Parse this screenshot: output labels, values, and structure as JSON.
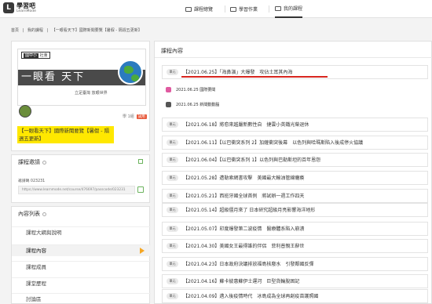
{
  "app": {
    "logo_name": "學習吧",
    "logo_sub": "LearnMode",
    "logo_glyph": "L"
  },
  "nav": [
    {
      "label": "課程總覽",
      "icon": "book-icon"
    },
    {
      "label": "學習作業",
      "icon": "clipboard-icon"
    },
    {
      "label": "我的課程",
      "icon": "course-icon",
      "active": true
    }
  ],
  "breadcrumb": [
    "首頁",
    "|",
    "我的課程",
    "|",
    "【一眼看天下】國際新聞要覽【暑假 - 隔週五更新】"
  ],
  "course": {
    "tag_left": "國中小",
    "tag_right": "社會",
    "banner_title": "一眼看 天下",
    "banner_sub": "立足臺灣 放眼世界",
    "meta_count": "學 1組",
    "badge": "試用",
    "title": "【一眼看天下】國際新聞要覽【暑假 - 隔週五更新】"
  },
  "code": {
    "heading": "課程邀請",
    "code_label": "邀請碼 023231",
    "url": "https://www.learnmode.net/course/476697/passcode/023231"
  },
  "menu": {
    "heading": "內容列表",
    "items": [
      {
        "label": "課程大綱與說明"
      },
      {
        "label": "課程內容",
        "active": true
      },
      {
        "label": "課程成員"
      },
      {
        "label": "課堂歷程"
      },
      {
        "label": "討論區"
      }
    ]
  },
  "content": {
    "heading": "課程內容",
    "rows": [
      {
        "pill": "單元",
        "text": "【2021.06.25】「海鼻演」大爆發　攻佔土耳其內海"
      },
      {
        "pill": "單元",
        "text": "【2021.06.18】將愈來越嚴新數性自　捷雲小英鐵光榮退休"
      },
      {
        "pill": "單元",
        "text": "【2021.06.11】【以巴衝突系列 2】加薩衝突後幕　以色列與哈瑪斯陷入後成停火協議"
      },
      {
        "pill": "單元",
        "text": "【2021.06.04】【以巴衝突系列 1】以色列與巴勒斯坦的百年恩怨"
      },
      {
        "pill": "單元",
        "text": "【2021.05.28】遭勒索網書攻擊　美國最大輸油管線癱瘓"
      },
      {
        "pill": "單元",
        "text": "【2021.05.21】西班牙國全球首例　將試辦一週工作四天"
      },
      {
        "pill": "單元",
        "text": "【2021.05.14】超級僵月來了 日本研究超級月亮影響海洋地形"
      },
      {
        "pill": "單元",
        "text": "【2021.05.07】印度爆發第二波疫情　醫療體系陷入崩潰"
      },
      {
        "pill": "單元",
        "text": "【2021.04.30】美國女王最得誰的伴侶　菲利普親王辭世"
      },
      {
        "pill": "單元",
        "text": "【2021.04.23】日本政府決議排放福島核廢水　引發鄰國反彈"
      },
      {
        "pill": "單元",
        "text": "【2021.04.16】蘇卡彼惠蘇伊士運河　巨型貨輪脫困記"
      },
      {
        "pill": "單元",
        "text": "【2021.04.09】邁入後疫情時代　冰島成為全球再創疫苗護照國"
      }
    ],
    "subitems": [
      {
        "text": "2021.06.25 國際要聞"
      },
      {
        "text": "2021.06.25 新聞動動腦"
      }
    ]
  },
  "colors": {
    "accent": "#d8261f",
    "highlight": "#ffe800",
    "pill_bg": "#e9e9e9",
    "sub_pink": "#e05aa0"
  }
}
